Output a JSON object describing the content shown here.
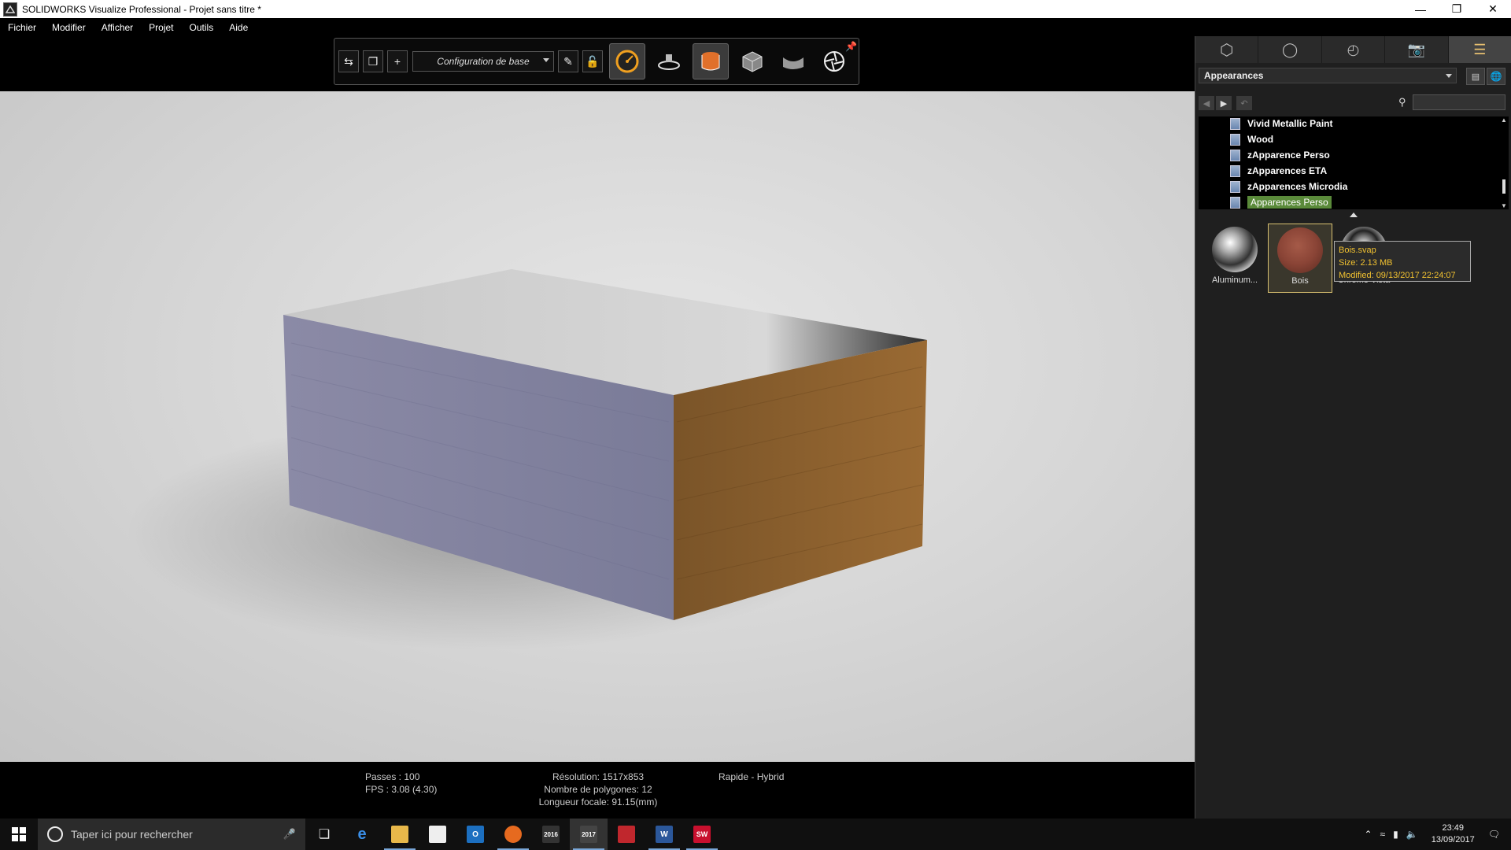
{
  "window": {
    "title": "SOLIDWORKS Visualize Professional - Projet sans titre *",
    "app_icon": "sw-visualize-icon"
  },
  "menu": [
    "Fichier",
    "Modifier",
    "Afficher",
    "Projet",
    "Outils",
    "Aide"
  ],
  "toolbar": {
    "config_label": "Configuration de base"
  },
  "status": {
    "passes": "Passes : 100",
    "fps": "FPS : 3.08 (4.30)",
    "resolution": "Résolution: 1517x853",
    "polygons": "Nombre de polygones: 12",
    "focal": "Longueur focale: 91.15(mm)",
    "mode": "Rapide - Hybrid"
  },
  "panel": {
    "dropdown": "Appearances",
    "tree": [
      {
        "label": "Vivid Metallic Paint"
      },
      {
        "label": "Wood"
      },
      {
        "label": "zApparence Perso"
      },
      {
        "label": "zApparences ETA"
      },
      {
        "label": "zApparences Microdia"
      },
      {
        "label": "Apparences Perso",
        "selected": true
      }
    ],
    "thumbnails": [
      {
        "label": "Aluminum..."
      },
      {
        "label": "Bois"
      },
      {
        "label": "Chrome Vista"
      }
    ],
    "tooltip": {
      "name": "Bois.svap",
      "size": "Size: 2.13 MB",
      "modified": "Modified: 09/13/2017 22:24:07"
    }
  },
  "taskbar": {
    "search_placeholder": "Taper ici pour rechercher",
    "time": "23:49",
    "date": "13/09/2017",
    "app_labels": {
      "sw2016": "2016",
      "sw2017": "2017",
      "solidworks": "SW"
    }
  },
  "colors": {
    "accent_select": "#5a8a3a",
    "tooltip_text": "#f2c230",
    "active_orange": "#e0702a"
  }
}
